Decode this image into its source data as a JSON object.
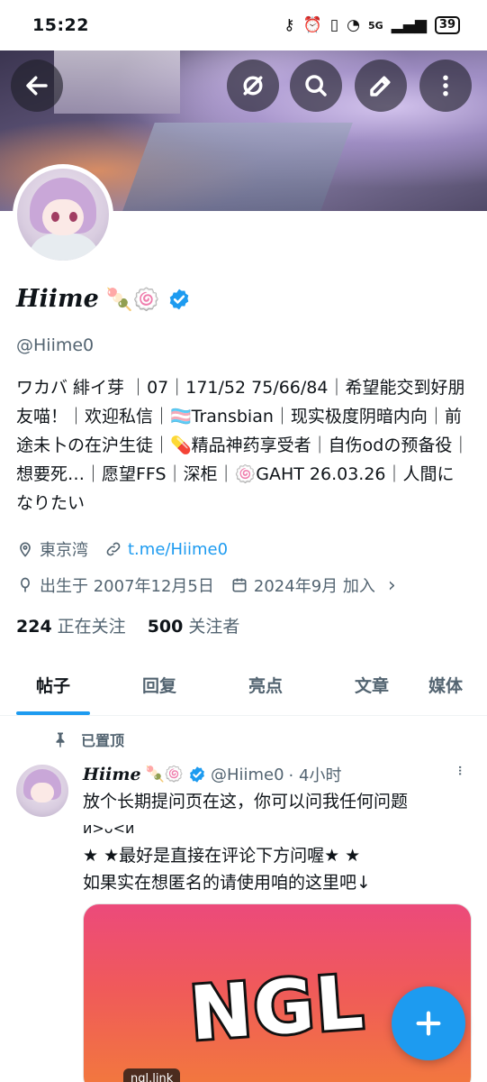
{
  "status_bar": {
    "time": "15:22",
    "network": "5G",
    "battery": "39"
  },
  "header": {
    "back_icon": "arrow-left-icon",
    "actions": [
      "fediverse-icon",
      "search-icon",
      "edit-icon",
      "more-vertical-icon"
    ]
  },
  "profile": {
    "display_name": "Hiime",
    "name_emojis": "🍡🍥",
    "handle": "@Hiime0",
    "bio": "ワカバ 緋イ芽 ｜07｜171/52 75/66/84｜希望能交到好朋友喵！｜欢迎私信｜🏳️‍⚧️Transbian｜现实极度阴暗内向｜前途未卜の在沪生徒｜💊精品神药享受者｜自伤odの预备役｜想要死…｜愿望FFS｜深柜｜🍥GAHT 26.03.26｜人間になりたい",
    "location": "東京湾",
    "link": "t.me/Hiime0",
    "birthday": "出生于 2007年12月5日",
    "joined": "2024年9月 加入",
    "following_count": "224",
    "following_label": "正在关注",
    "followers_count": "500",
    "followers_label": "关注者"
  },
  "tabs": [
    {
      "label": "帖子",
      "active": true
    },
    {
      "label": "回复"
    },
    {
      "label": "亮点"
    },
    {
      "label": "文章"
    },
    {
      "label": "媒体"
    }
  ],
  "pinned_post": {
    "pinned_label": "已置顶",
    "author": "Hiime",
    "author_emojis": "🍡🍥",
    "handle": "@Hiime0",
    "time": "· 4小时",
    "text_line1": "放个长期提问页在这，你可以问我任何问题",
    "text_line2": "ᴎ>ᴗ<ᴎ",
    "text_line3": "★ ★最好是直接在评论下方问喔★ ★",
    "text_line4": "如果实在想匿名的请使用咱的这里吧↓",
    "media_title": "NGL",
    "media_tag": "ngl.link"
  },
  "colors": {
    "accent": "#1d9bf0",
    "text": "#0f1419",
    "secondary": "#536471"
  }
}
